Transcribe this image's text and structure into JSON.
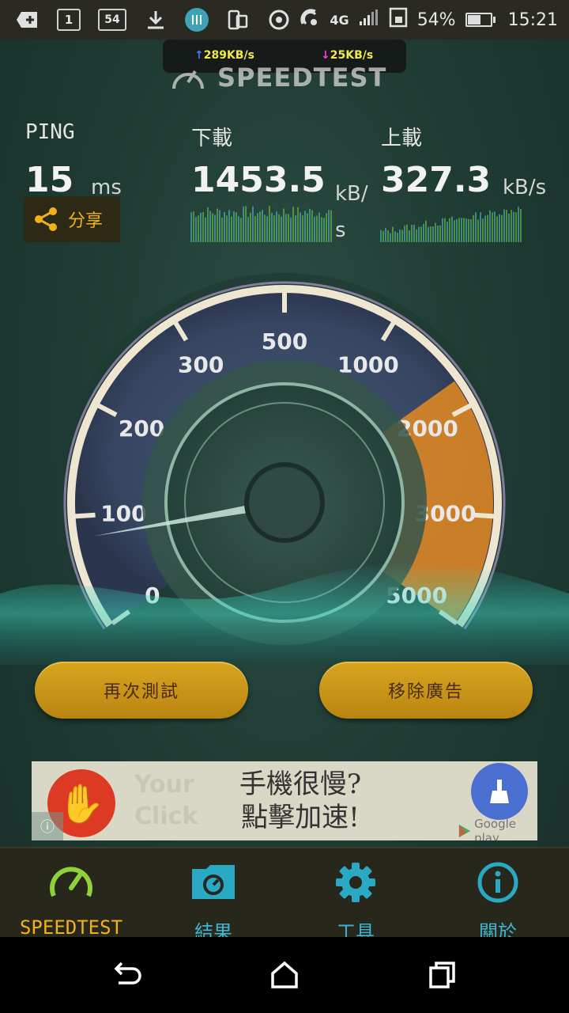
{
  "status_bar": {
    "calendar_day": "1",
    "notification_count": "54",
    "network_type": "4G",
    "battery_percent": "54%",
    "time": "15:21"
  },
  "net_speed_overlay": {
    "upload": "289KB/s",
    "download": "25KB/s"
  },
  "app": {
    "logo": "SPEEDTEST"
  },
  "results": {
    "ping_label": "PING",
    "ping_value": "15",
    "ping_unit": "ms",
    "download_label": "下載",
    "download_value": "1453.5",
    "download_unit": "kB/s",
    "upload_label": "上載",
    "upload_value": "327.3",
    "upload_unit": "kB/s",
    "share_label": "分享"
  },
  "gauge": {
    "ticks": [
      "0",
      "100",
      "200",
      "300",
      "500",
      "1000",
      "2000",
      "3000",
      "5000"
    ],
    "needle_value": 0.1,
    "highlight_color": "#e58a20"
  },
  "actions": {
    "retest_label": "再次測試",
    "remove_ads_label": "移除廣告"
  },
  "ad": {
    "line1": "手機很慢?",
    "line2": "點擊加速!",
    "bg_line1": "Your",
    "bg_line2": "Click",
    "store_label": "Google play"
  },
  "tabs": [
    {
      "label": "SPEEDTEST",
      "icon": "speedometer-icon",
      "active": true
    },
    {
      "label": "結果",
      "icon": "results-folder-icon",
      "active": false
    },
    {
      "label": "工具",
      "icon": "gear-icon",
      "active": false
    },
    {
      "label": "關於",
      "icon": "info-icon",
      "active": false
    }
  ],
  "colors": {
    "accent_yellow": "#f0b21b",
    "active_tab": "#8fd13a",
    "tab_icon": "#2aa9c4",
    "tab_label": "#3bb7d3"
  }
}
